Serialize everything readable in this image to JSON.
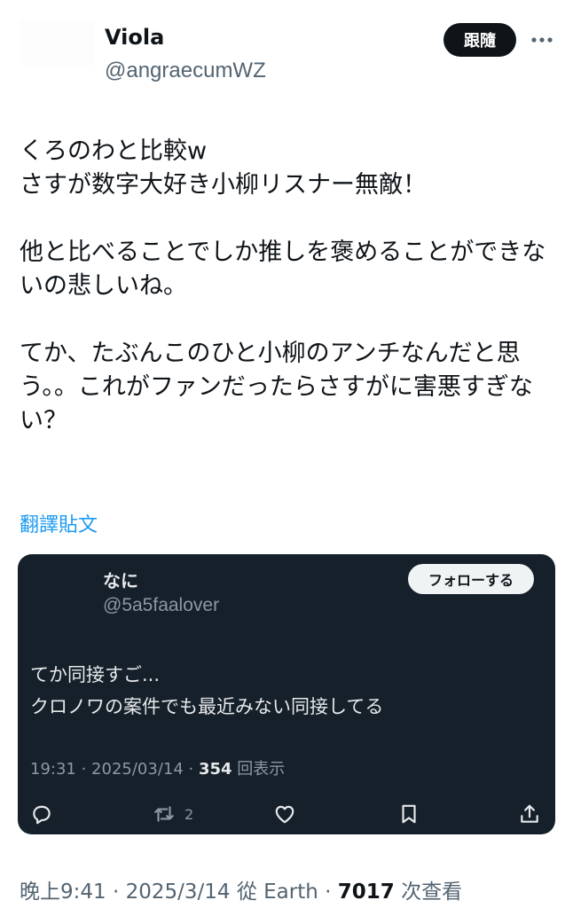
{
  "post": {
    "author_name": "Viola",
    "author_handle": "@angraecumWZ",
    "follow_label": "跟隨",
    "more_icon": "more-horizontal-icon",
    "text": "くろのわと比較w\nさすが数字大好き小柳リスナー無敵！\n\n他と比べることでしか推しを褒めることができないの悲しいね。\n\nてか、たぶんこのひと小柳のアンチなんだと思う。。これがファンだったらさすがに害悪すぎない？",
    "translate_label": "翻譯貼文",
    "time": "晚上9:41",
    "date": "2025/3/14",
    "source": "從 Earth",
    "views_count": "7017",
    "views_label": "次查看"
  },
  "quoted": {
    "author_name": "なに",
    "author_handle": "@5a5faalover",
    "follow_label": "フォローする",
    "text": "てか同接すご...\nクロノワの案件でも最近みない同接してる",
    "time": "19:31",
    "date": "2025/03/14",
    "views_count": "354",
    "views_label": "回表示",
    "actions": {
      "reply_icon": "reply-icon",
      "retweet_icon": "retweet-icon",
      "retweet_count": "2",
      "like_icon": "heart-icon",
      "bookmark_icon": "bookmark-icon",
      "share_icon": "share-icon"
    }
  },
  "colors": {
    "link": "#1d9bf0",
    "card_bg": "#15202b",
    "secondary_text": "#536471"
  }
}
